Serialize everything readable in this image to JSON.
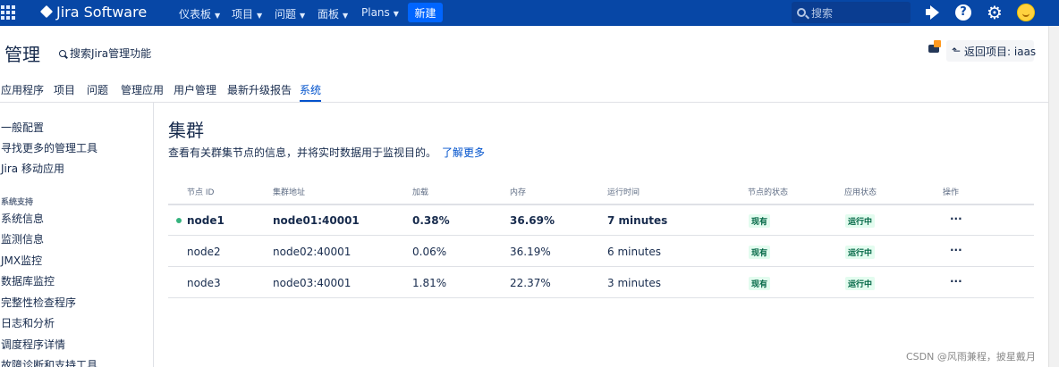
{
  "topbar": {
    "app_name": "Jira Software",
    "nav": [
      "仪表板",
      "项目",
      "问题",
      "面板",
      "Plans"
    ],
    "create_label": "新建",
    "search_placeholder": "搜索",
    "icons": [
      "app-switcher-icon",
      "jira-logo-icon",
      "notifications-icon",
      "help-icon",
      "settings-icon",
      "avatar"
    ]
  },
  "admin": {
    "title": "管理",
    "search_label": "搜索Jira管理功能",
    "back_label": "返回项目: iaas"
  },
  "tabs": [
    "应用程序",
    "项目",
    "问题",
    "管理应用",
    "用户管理",
    "最新升级报告",
    "系统"
  ],
  "active_tab": "系统",
  "sidebar": {
    "items_top": [
      "一般配置",
      "寻找更多的管理工具",
      "Jira 移动应用"
    ],
    "section_heading": "系统支持",
    "items_support": [
      "系统信息",
      "监测信息",
      "JMX监控",
      "数据库监控",
      "完整性检查程序",
      "日志和分析",
      "调度程序详情",
      "故障诊断和支持工具"
    ]
  },
  "main": {
    "title": "集群",
    "description": "查看有关群集节点的信息，并将实时数据用于监视目的。",
    "learn_more": "了解更多"
  },
  "table": {
    "headers": [
      "节点 ID",
      "集群地址",
      "加载",
      "内存",
      "运行时间",
      "节点的状态",
      "应用状态",
      "操作"
    ],
    "rows": [
      {
        "node": "node1",
        "address": "node01:40001",
        "load": "0.38%",
        "memory": "36.69%",
        "uptime": "7 minutes",
        "node_state": "现有",
        "app_state": "运行中",
        "actions": "···"
      },
      {
        "node": "node2",
        "address": "node02:40001",
        "load": "0.06%",
        "memory": "36.19%",
        "uptime": "6 minutes",
        "node_state": "现有",
        "app_state": "运行中",
        "actions": "···"
      },
      {
        "node": "node3",
        "address": "node03:40001",
        "load": "1.81%",
        "memory": "22.37%",
        "uptime": "3 minutes",
        "node_state": "现有",
        "app_state": "运行中",
        "actions": "···"
      }
    ]
  },
  "watermark": "CSDN @风雨兼程，披星戴月",
  "colors": {
    "topbar": "#0747a6",
    "create": "#0065ff",
    "link": "#0052cc",
    "success_bg": "#e3fcef",
    "success_text": "#006644"
  }
}
